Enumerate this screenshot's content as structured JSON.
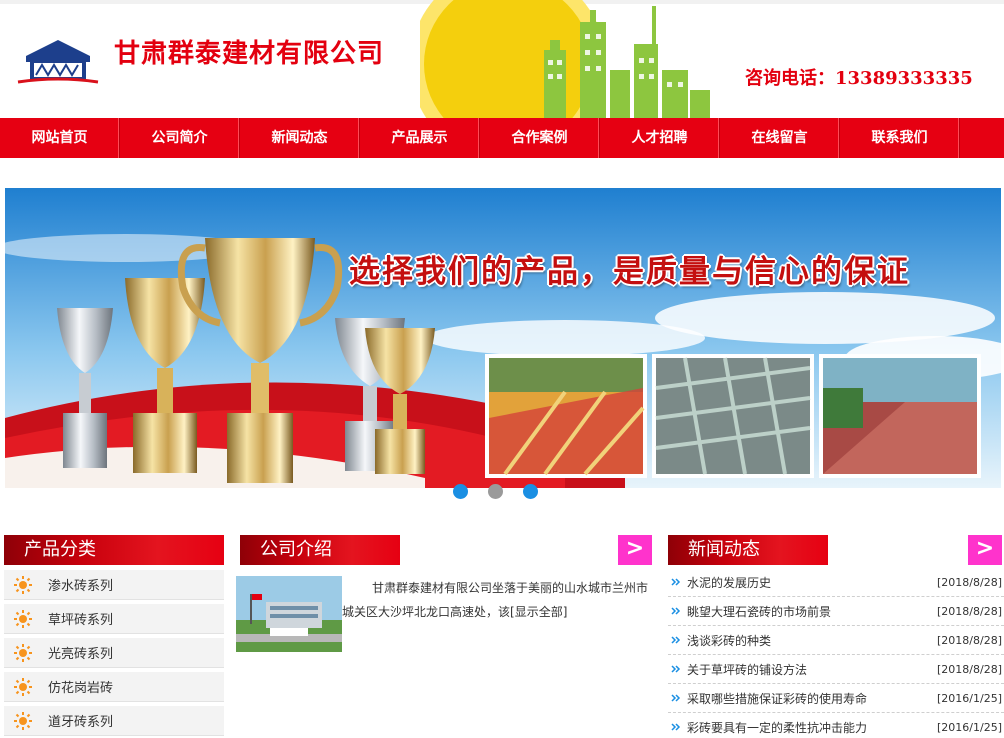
{
  "header": {
    "company_name": "甘肃群泰建材有限公司",
    "hotline": "咨询电话：13389333335"
  },
  "nav": {
    "items": [
      {
        "label": "网站首页"
      },
      {
        "label": "公司简介"
      },
      {
        "label": "新闻动态"
      },
      {
        "label": "产品展示"
      },
      {
        "label": "合作案例"
      },
      {
        "label": "人才招聘"
      },
      {
        "label": "在线留言"
      },
      {
        "label": "联系我们"
      }
    ]
  },
  "banner": {
    "slogan": "选择我们的产品，是质量与信心的保证",
    "dots": [
      {
        "state": "active",
        "color": "#1a8fe3"
      },
      {
        "state": "inactive",
        "color": "#9a9a9a"
      },
      {
        "state": "active",
        "color": "#1a8fe3"
      }
    ]
  },
  "categories": {
    "title": "产品分类",
    "items": [
      {
        "label": "渗水砖系列"
      },
      {
        "label": "草坪砖系列"
      },
      {
        "label": "光亮砖系列"
      },
      {
        "label": "仿花岗岩砖"
      },
      {
        "label": "道牙砖系列"
      }
    ]
  },
  "intro": {
    "title": "公司介绍",
    "more_icon": ">",
    "text": "甘肃群泰建材有限公司坐落于美丽的山水城市兰州市城关区大沙坪北龙口高速处，该",
    "more_link": "[显示全部]"
  },
  "news": {
    "title": "新闻动态",
    "more_icon": ">",
    "items": [
      {
        "title": "水泥的发展历史",
        "date": "[2018/8/28]"
      },
      {
        "title": "眺望大理石瓷砖的市场前景",
        "date": "[2018/8/28]"
      },
      {
        "title": "浅谈彩砖的种类",
        "date": "[2018/8/28]"
      },
      {
        "title": "关于草坪砖的铺设方法",
        "date": "[2018/8/28]"
      },
      {
        "title": "采取哪些措施保证彩砖的使用寿命",
        "date": "[2016/1/25]"
      },
      {
        "title": "彩砖要具有一定的柔性抗冲击能力",
        "date": "[2016/1/25]"
      }
    ]
  },
  "colors": {
    "brand_red": "#e60012",
    "more_pink": "#ff33cc",
    "dot_blue": "#1a8fe3"
  }
}
